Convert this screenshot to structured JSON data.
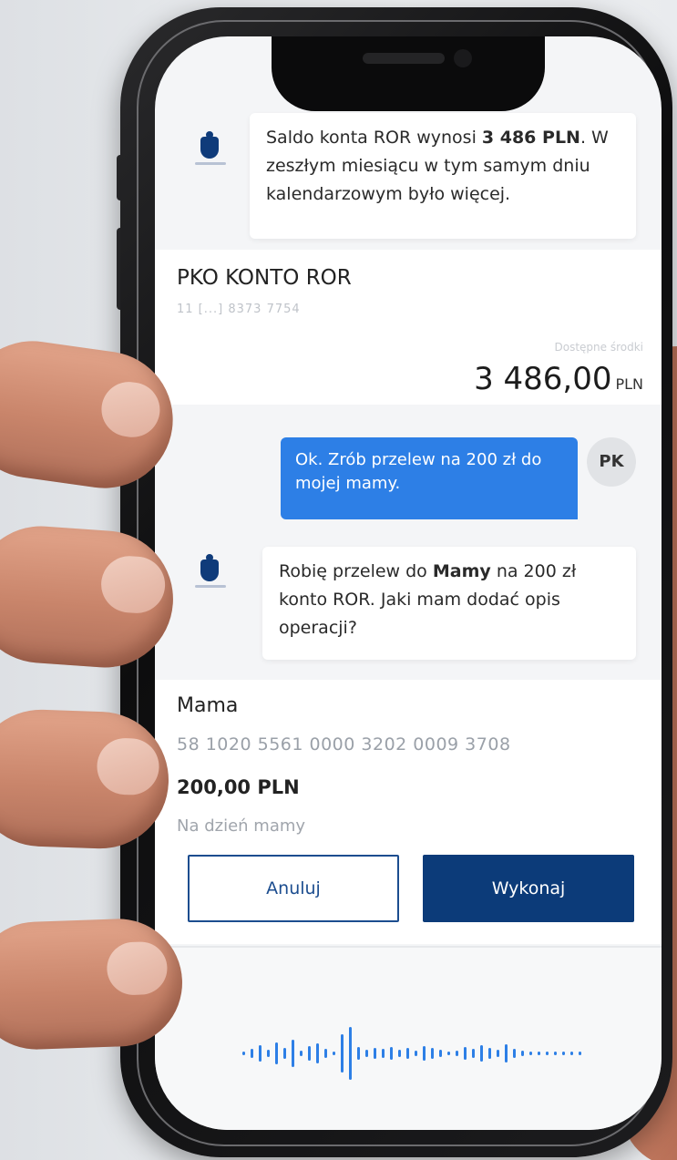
{
  "chat": {
    "bot_msg_1": {
      "prefix": "Saldo konta ROR wynosi ",
      "bold": "3 486 PLN",
      "suffix": ". W zeszłym miesiącu w tym samym dniu kalendarzowym było więcej."
    },
    "account_card": {
      "name": "PKO KONTO ROR",
      "number": "11 [...] 8373 7754",
      "balance_label": "Dostępne środki",
      "balance_value": "3 486,00",
      "balance_currency": "PLN"
    },
    "user_msg": {
      "text": "Ok. Zrób przelew na 200 zł do mojej mamy.",
      "avatar_initials": "PK"
    },
    "bot_msg_2": {
      "prefix": "Robię przelew do ",
      "bold": "Mamy",
      "suffix": " na 200 zł konto ROR. Jaki mam dodać opis operacji?"
    },
    "transfer_card": {
      "recipient": "Mama",
      "account": "58 1020 5561 0000 3202 0009 3708",
      "amount": "200,00 PLN",
      "description": "Na dzień mamy",
      "cancel_label": "Anuluj",
      "confirm_label": "Wykonaj"
    }
  },
  "colors": {
    "brand_navy": "#0c3b79",
    "user_bubble": "#2d7fe6",
    "voice_wave": "#2d7fe6"
  },
  "icons": {
    "bot_avatar": "pko-shield-logo",
    "voice": "voice-waveform-icon"
  }
}
